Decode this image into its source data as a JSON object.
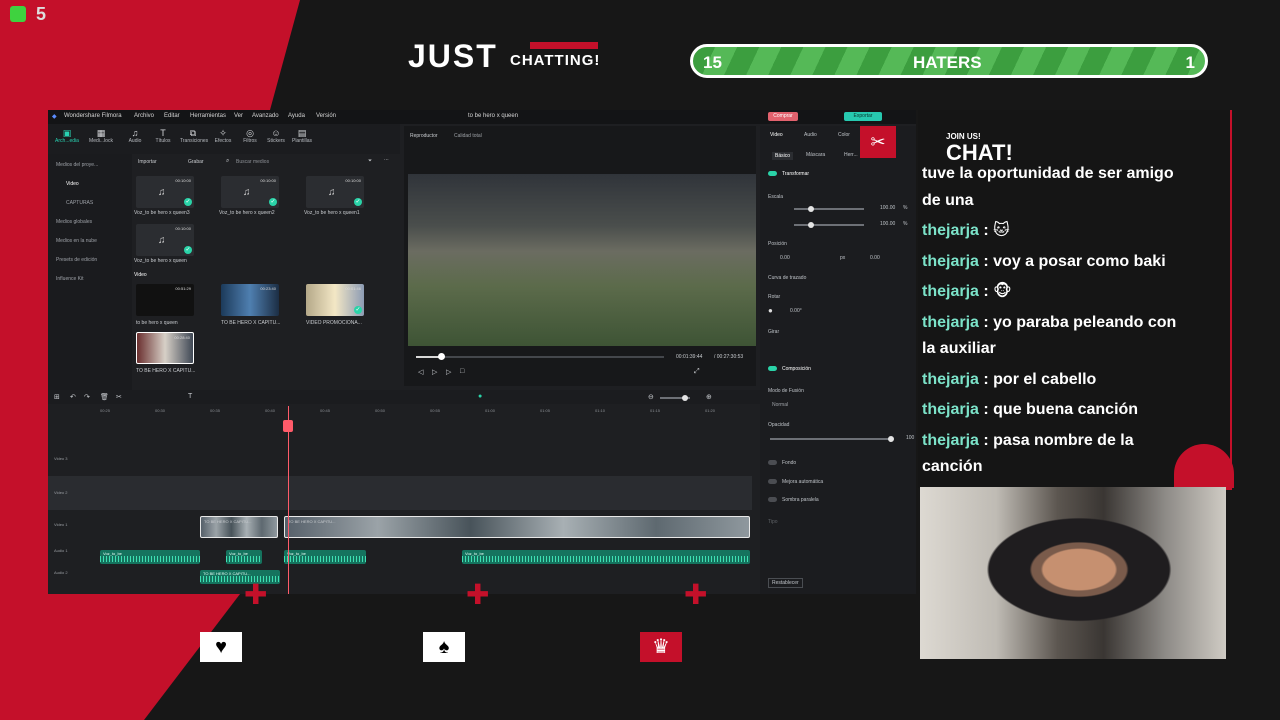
{
  "overlay": {
    "channel_badge": "5",
    "just": "JUST",
    "chatting": "CHATTING!",
    "haters": {
      "left": "15",
      "label": "HATERS",
      "right": "1"
    }
  },
  "editor": {
    "app_name": "Wondershare Filmora",
    "menus": [
      "Archivo",
      "Editar",
      "Herramientas",
      "Ver",
      "Avanzado",
      "Ayuda",
      "Versión"
    ],
    "project_title": "to be hero x queen",
    "buy_label": "Comprar",
    "export_label": "Exportar",
    "tools": [
      "Arch...edia",
      "Medi...lock",
      "Audio",
      "Títulos",
      "Transiciones",
      "Efectos",
      "Filtros",
      "Stickers",
      "Plantillas"
    ],
    "sidebar": [
      "Medios del proye...",
      "Video",
      "CAPTURAS",
      "Medios globales",
      "Medios en la nube",
      "Presets de edición",
      "Influence Kit"
    ],
    "media_bar": {
      "import": "Importar",
      "record": "Grabar",
      "search": "Buscar medios"
    },
    "audio_items": [
      {
        "dur": "00:10:00",
        "name": "Voz_to be hero x queen3"
      },
      {
        "dur": "00:10:00",
        "name": "Voz_to be hero x queen2"
      },
      {
        "dur": "00:10:00",
        "name": "Voz_to be hero x queen1"
      },
      {
        "dur": "00:10:00",
        "name": "Voz_to be hero x queen"
      }
    ],
    "video_folder": "Video",
    "video_items": [
      {
        "dur": "00:51:29",
        "name": "to be hero x queen"
      },
      {
        "dur": "00:23:40",
        "name": "TO BE HERO X CAPITU..."
      },
      {
        "dur": "00:01:46",
        "name": "VIDEO PROMOCIONA..."
      },
      {
        "dur": "00:28:40",
        "name": "TO BE HERO X CAPITU..."
      }
    ],
    "player": {
      "label": "Reproductor",
      "quality": "Calidad total",
      "current_time": "00:01:39:44",
      "total_time": "/ 00:27:30:53",
      "progress": 0.1
    },
    "panel": {
      "tabs": [
        "Video",
        "Audio",
        "Color"
      ],
      "subtabs": [
        "Básico",
        "Máscara",
        "Herr..."
      ],
      "transform": "Transformar",
      "scale": "Escala",
      "x_val": "100.00",
      "y_val": "100.00",
      "pct": "%",
      "position": "Posición",
      "pos_x": "0.00",
      "pos_y": "0.00",
      "px": "px",
      "curve": "Curva de trazado",
      "rotate": "Rotar",
      "rot_val": "0.00°",
      "flip": "Girar",
      "composition": "Composición",
      "blend": "Modo de Fusión",
      "blend_val": "Normal",
      "opacity": "Opacidad",
      "opacity_val": "100",
      "background": "Fondo",
      "auto_enhance": "Mejora automática",
      "shadow": "Sombra paralela",
      "type": "Tipo",
      "reset": "Restablecer"
    },
    "ruler": [
      "00:25",
      "00:30",
      "00:35",
      "00:40",
      "00:45",
      "00:50",
      "00:55",
      "01:00",
      "01:05",
      "01:10",
      "01:15",
      "01:20"
    ],
    "tracks": [
      "Video 3",
      "Video 2",
      "Video 1",
      "Audio 1",
      "Audio 2"
    ],
    "clips": {
      "video_a": "TO BE HERO X CAPITU...",
      "video_b": "TO BE HERO X CAPITU...",
      "audio": "Voz_to_be",
      "audio2": "TO BE HERO X CAPITU..."
    }
  },
  "chat": {
    "join": "JOIN US!",
    "title": "CHAT!",
    "messages": [
      {
        "user": "",
        "text": "tuve la oportunidad de ser amigo"
      },
      {
        "user": "",
        "text": "de una"
      },
      {
        "user": "thejarja",
        "text": " : 🐱"
      },
      {
        "user": "thejarja",
        "text": " : voy a posar como baki"
      },
      {
        "user": "thejarja",
        "text": " : 🐵"
      },
      {
        "user": "thejarja",
        "text": " : yo paraba peleando con"
      },
      {
        "user": "",
        "text": "la auxiliar"
      },
      {
        "user": "thejarja",
        "text": " : por el cabello"
      },
      {
        "user": "thejarja",
        "text": " : que buena canción"
      },
      {
        "user": "thejarja",
        "text": " : pasa nombre de la"
      },
      {
        "user": "",
        "text": "canción"
      }
    ]
  },
  "suits": {
    "heart": "♥",
    "spade": "♠",
    "crown": "♛",
    "plus": "✚"
  }
}
